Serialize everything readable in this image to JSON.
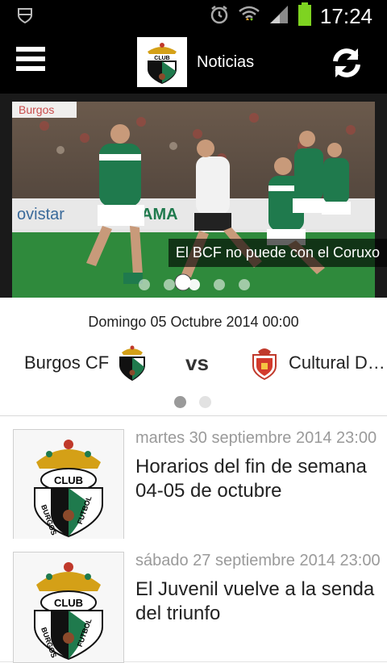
{
  "status_bar": {
    "time": "17:24"
  },
  "header": {
    "title": "Noticias"
  },
  "hero": {
    "caption": "El BCF no puede con el Coruxo",
    "dots_count": 5,
    "active_dot": 2
  },
  "match": {
    "date": "Domingo 05 Octubre 2014 00:00",
    "home_team": "Burgos CF",
    "vs": "vs",
    "away_team": "Cultural D…",
    "page_dots": 2,
    "active_page": 0
  },
  "news": [
    {
      "date": "martes 30 septiembre 2014 23:00",
      "title": "Horarios del fin de semana 04-05 de octubre"
    },
    {
      "date": "sábado 27 septiembre 2014 23:00",
      "title": "El Juvenil vuelve a la senda del triunfo"
    }
  ],
  "crest_text": {
    "club": "CLUB",
    "left": "BURGOS",
    "right": "FUTBOL"
  },
  "hero_signage": {
    "ad1": "Burgos",
    "ad2": "ovistar",
    "ad3": "AMA"
  },
  "colors": {
    "bar": "#000000",
    "accent_green": "#1f7a4d",
    "battery": "#7ed321"
  }
}
